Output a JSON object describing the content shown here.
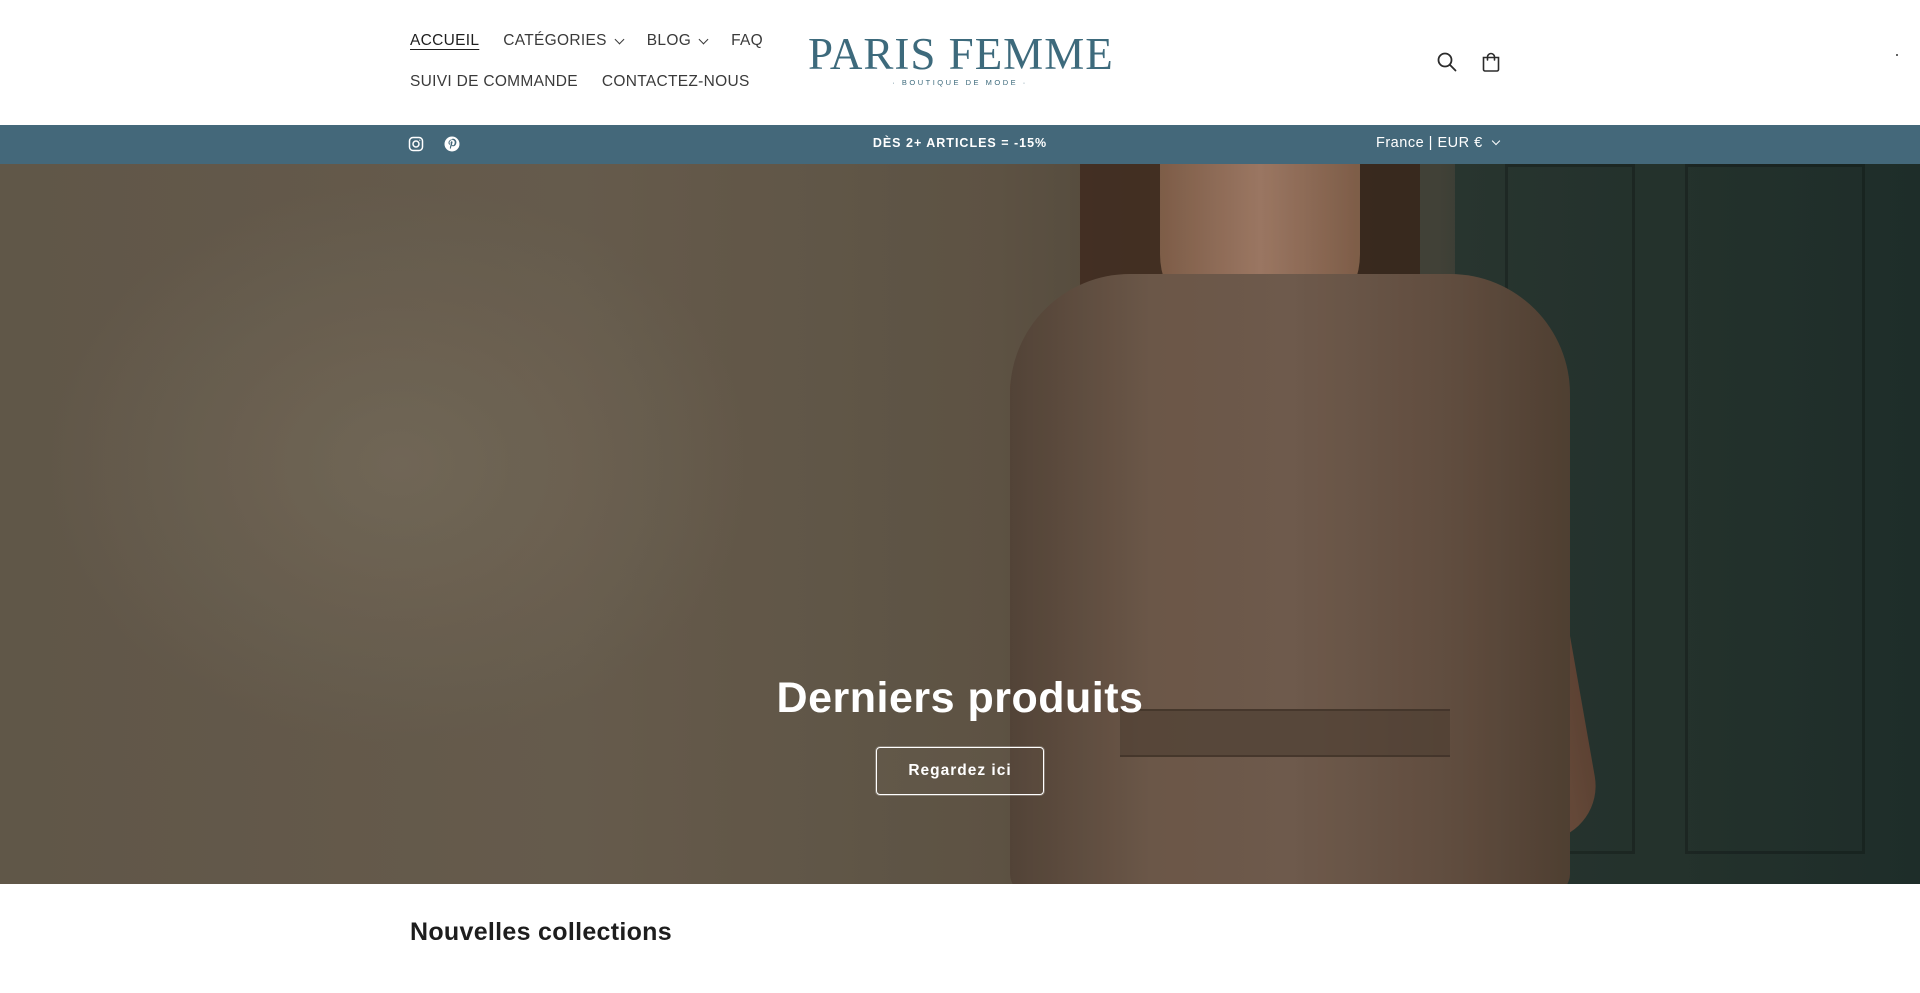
{
  "header": {
    "nav": {
      "row1": [
        {
          "label": "ACCUEIL",
          "active": true
        },
        {
          "label": "CATÉGORIES",
          "dropdown": true
        },
        {
          "label": "BLOG",
          "dropdown": true
        },
        {
          "label": "FAQ"
        }
      ],
      "row2": [
        {
          "label": "SUIVI DE COMMANDE"
        },
        {
          "label": "CONTACTEZ-NOUS"
        }
      ]
    },
    "logo": {
      "main": "PARIS FEMME",
      "sub": "· BOUTIQUE DE MODE ·",
      "color": "#3d6a7c"
    },
    "icons": {
      "search": "search-icon",
      "cart": "cart-icon"
    }
  },
  "announcement": {
    "text": "DÈS 2+ ARTICLES = -15%",
    "background": "#44687a",
    "social": [
      "instagram-icon",
      "pinterest-icon"
    ],
    "locale": "France | EUR €"
  },
  "hero": {
    "title": "Derniers produits",
    "button_label": "Regardez ici"
  },
  "sections": {
    "new_collections_title": "Nouvelles collections"
  }
}
